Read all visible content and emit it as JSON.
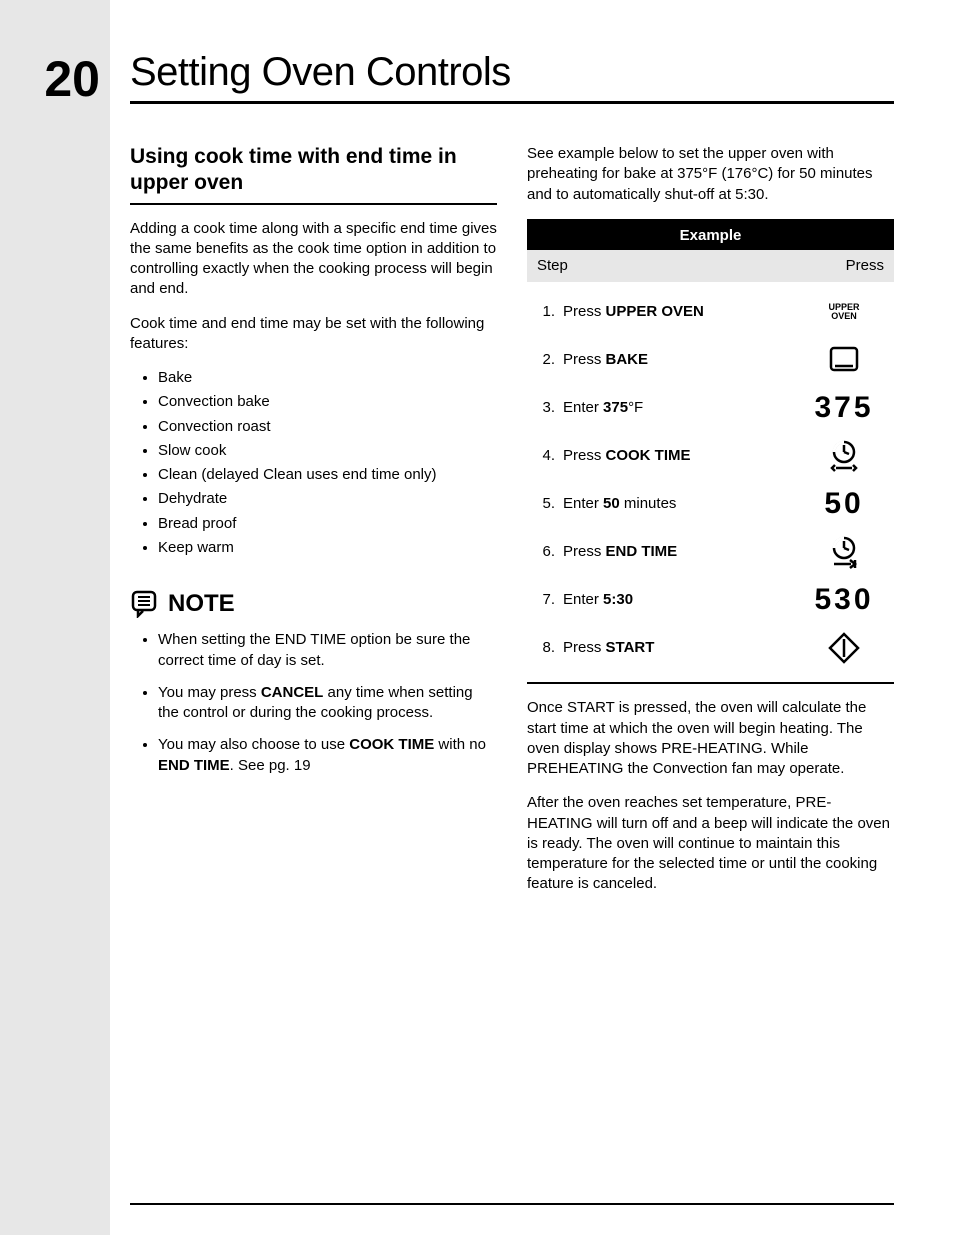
{
  "page_number": "20",
  "page_title": "Setting Oven Controls",
  "section_heading": "Using cook time with end time in upper oven",
  "intro_para_1": "Adding a cook time along with a specific end time gives the same benefits as the cook time option in addition to controlling exactly when the cooking process will begin and end.",
  "intro_para_2": "Cook time and end time may be set with the following features:",
  "features": [
    "Bake",
    "Convection bake",
    "Convection roast",
    "Slow cook",
    "Clean (delayed Clean uses end time only)",
    "Dehydrate",
    "Bread proof",
    "Keep warm"
  ],
  "note_label": "NOTE",
  "notes": {
    "n1a": "When setting the END TIME option be sure the correct time of day is set.",
    "n2a": "You may press ",
    "n2b": "CANCEL",
    "n2c": " any time when setting the control or during the cooking process.",
    "n3a": "You may also choose to use ",
    "n3b": "COOK TIME",
    "n3c": " with no ",
    "n3d": "END TIME",
    "n3e": ". See pg. 19"
  },
  "right_intro": "See example below to set the upper oven with preheating for bake at 375°F (176°C) for 50 minutes and to automatically shut-off at 5:30.",
  "example_title": "Example",
  "col_step": "Step",
  "col_press": "Press",
  "rows": [
    {
      "num": "1.",
      "pre": "Press ",
      "bold": "UPPER OVEN",
      "post": "",
      "press_type": "upper",
      "press_value": "UPPER OVEN"
    },
    {
      "num": "2.",
      "pre": "Press ",
      "bold": "BAKE",
      "post": "",
      "press_type": "bake",
      "press_value": ""
    },
    {
      "num": "3.",
      "pre": "Enter ",
      "bold": "375",
      "post": "°F",
      "press_type": "digits",
      "press_value": "375"
    },
    {
      "num": "4.",
      "pre": "Press ",
      "bold": "COOK TIME",
      "post": "",
      "press_type": "cook",
      "press_value": ""
    },
    {
      "num": "5.",
      "pre": "Enter ",
      "bold": "50",
      "post": " minutes",
      "press_type": "digits",
      "press_value": "50"
    },
    {
      "num": "6.",
      "pre": "Press ",
      "bold": "END TIME",
      "post": "",
      "press_type": "end",
      "press_value": ""
    },
    {
      "num": "7.",
      "pre": "Enter ",
      "bold": "5:30",
      "post": "",
      "press_type": "digits",
      "press_value": "530"
    },
    {
      "num": "8.",
      "pre": "Press ",
      "bold": "START",
      "post": "",
      "press_type": "start",
      "press_value": ""
    }
  ],
  "right_para_1": "Once START is pressed, the oven will calculate the start time at which the oven will begin heating. The oven display shows PRE-HEATING. While PREHEATING the Convection fan may operate.",
  "right_para_2": "After the oven reaches set temperature, PRE-HEATING will turn off and a beep will indicate the oven is ready. The oven will continue to maintain this temperature for the selected time or until the cooking feature is canceled."
}
